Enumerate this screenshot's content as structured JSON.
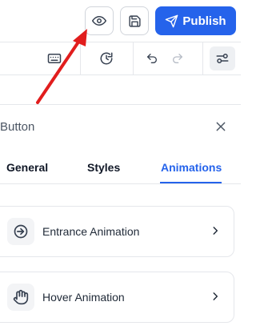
{
  "header": {
    "publish_label": "Publish",
    "preview_icon": "eye-icon",
    "save_icon": "floppy-disk-icon",
    "publish_icon": "send-icon"
  },
  "toolbar": {
    "icons": [
      "keyboard-icon",
      "history-icon",
      "undo-icon",
      "redo-icon",
      "sliders-icon"
    ]
  },
  "panel": {
    "title": "Button",
    "tabs": [
      {
        "label": "General",
        "active": false
      },
      {
        "label": "Styles",
        "active": false
      },
      {
        "label": "Animations",
        "active": true
      }
    ],
    "cards": [
      {
        "label": "Entrance Animation",
        "icon": "entrance-icon"
      },
      {
        "label": "Hover Animation",
        "icon": "hand-icon"
      }
    ]
  },
  "colors": {
    "accent": "#2563eb",
    "annotation_arrow": "#e11d1d",
    "border": "#e5e7eb"
  }
}
